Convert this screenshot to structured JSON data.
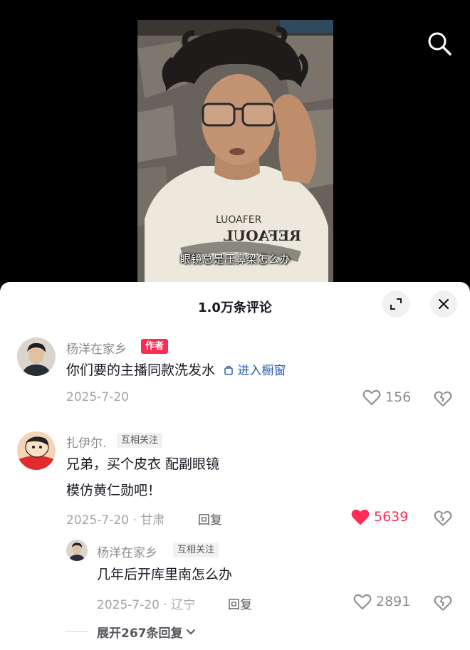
{
  "video": {
    "subtitle": "眼镜总是压鼻梁怎么办",
    "shirt_text_top": "LUOAFER",
    "shirt_text_mirror": "REFAOUL",
    "search_icon": "search-icon"
  },
  "sheet": {
    "title": "1.0万条评论",
    "expand_icon": "expand-icon",
    "close_icon": "close-icon"
  },
  "comments": [
    {
      "username": "杨洋在家乡",
      "badge": "作者",
      "text": "你们要的主播同款洗发水",
      "shop_link": "进入橱窗",
      "date": "2025-7-20",
      "likes": "156",
      "liked": false
    },
    {
      "username": "扎伊尔.",
      "badge": "互相关注",
      "text_line1": "兄弟，买个皮衣 配副眼镜",
      "text_line2": "模仿黄仁勋吧！",
      "date": "2025-7-20 · 甘肃",
      "reply_label": "回复",
      "likes": "5639",
      "liked": true
    },
    {
      "username": "杨洋在家乡",
      "badge": "互相关注",
      "text": "几年后开库里南怎么办",
      "date": "2025-7-20 · 辽宁",
      "reply_label": "回复",
      "likes": "2891",
      "liked": false
    }
  ],
  "expand_replies": "展开267条回复",
  "colors": {
    "accent": "#fe2c55",
    "link": "#2b5dba",
    "muted": "#8a8b91"
  }
}
